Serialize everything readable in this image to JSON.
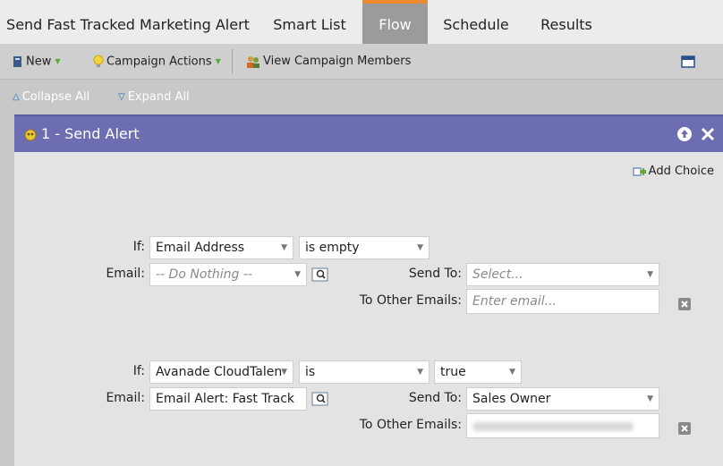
{
  "tabs": [
    {
      "label": "Send Fast Tracked Marketing Alert"
    },
    {
      "label": "Smart List"
    },
    {
      "label": "Flow"
    },
    {
      "label": "Schedule"
    },
    {
      "label": "Results"
    }
  ],
  "toolbar": {
    "new_label": "New",
    "campaign_actions_label": "Campaign Actions",
    "view_members_label": "View Campaign Members"
  },
  "subbar": {
    "collapse_label": "Collapse All",
    "expand_label": "Expand All"
  },
  "flow_step": {
    "title": "1 - Send Alert",
    "add_choice_label": "Add Choice"
  },
  "labels": {
    "if": "If:",
    "email": "Email:",
    "send_to": "Send To:",
    "to_other_emails": "To Other Emails:"
  },
  "choices": [
    {
      "if_field": "Email Address",
      "operator": "is empty",
      "email": "-- Do Nothing --",
      "send_to": "Select...",
      "other_emails_placeholder": "Enter email..."
    },
    {
      "if_field": "Avanade CloudTalen",
      "operator": "is",
      "value": "true",
      "email": "Email Alert: Fast Track",
      "send_to": "Sales Owner"
    }
  ],
  "colors": {
    "active_tab": "#9b9b9b",
    "active_tab_accent": "#ee8a2e",
    "panel_header": "#6d6eb1",
    "panel_body": "#e3e3e3"
  }
}
